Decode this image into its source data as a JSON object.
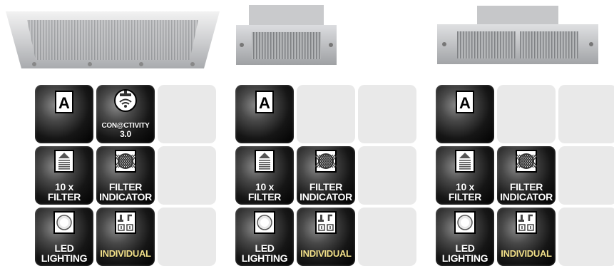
{
  "products": [
    {
      "hood_icon": "ceiling-hood-wide-image",
      "features": [
        {
          "type": "auto",
          "icon": "auto-a-icon",
          "label": "A"
        },
        {
          "type": "connectivity",
          "icon": "wifi-hood-icon",
          "label_line1": "CON@CTIVITY",
          "label_line2": "3.0"
        },
        {
          "type": "empty"
        },
        {
          "type": "filter",
          "icon": "filter-stack-icon",
          "label_line1": "10 x",
          "label_line2": "FILTER"
        },
        {
          "type": "indicator",
          "icon": "filter-grid-icon",
          "label_line1": "FILTER",
          "label_line2": "INDICATOR"
        },
        {
          "type": "empty"
        },
        {
          "type": "led",
          "icon": "led-light-icon",
          "label_line1": "LED",
          "label_line2": "LIGHTING"
        },
        {
          "type": "individual",
          "icon": "individual-controls-icon",
          "label": "INDIVIDUAL"
        },
        {
          "type": "empty"
        }
      ]
    },
    {
      "hood_icon": "ceiling-hood-small-image",
      "features": [
        {
          "type": "auto",
          "icon": "auto-a-icon",
          "label": "A"
        },
        {
          "type": "empty"
        },
        {
          "type": "empty"
        },
        {
          "type": "filter",
          "icon": "filter-stack-icon",
          "label_line1": "10 x",
          "label_line2": "FILTER"
        },
        {
          "type": "indicator",
          "icon": "filter-grid-icon",
          "label_line1": "FILTER",
          "label_line2": "INDICATOR"
        },
        {
          "type": "empty"
        },
        {
          "type": "led",
          "icon": "led-light-icon",
          "label_line1": "LED",
          "label_line2": "LIGHTING"
        },
        {
          "type": "individual",
          "icon": "individual-controls-icon",
          "label": "INDIVIDUAL"
        },
        {
          "type": "empty"
        }
      ]
    },
    {
      "hood_icon": "ceiling-hood-medium-image",
      "features": [
        {
          "type": "auto",
          "icon": "auto-a-icon",
          "label": "A"
        },
        {
          "type": "empty"
        },
        {
          "type": "empty"
        },
        {
          "type": "filter",
          "icon": "filter-stack-icon",
          "label_line1": "10 x",
          "label_line2": "FILTER"
        },
        {
          "type": "indicator",
          "icon": "filter-grid-icon",
          "label_line1": "FILTER",
          "label_line2": "INDICATOR"
        },
        {
          "type": "empty"
        },
        {
          "type": "led",
          "icon": "led-light-icon",
          "label_line1": "LED",
          "label_line2": "LIGHTING"
        },
        {
          "type": "individual",
          "icon": "individual-controls-icon",
          "label": "INDIVIDUAL"
        },
        {
          "type": "empty"
        }
      ]
    }
  ]
}
